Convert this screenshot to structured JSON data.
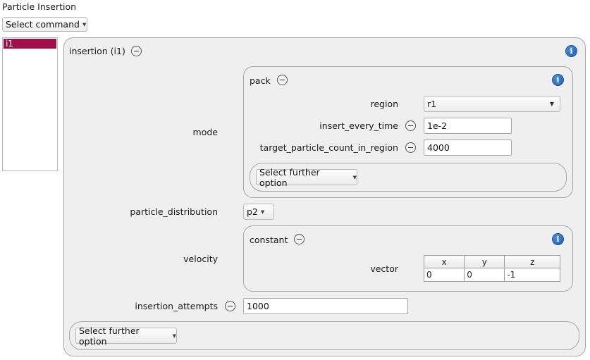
{
  "header": {
    "title": "Particle Insertion",
    "command_select": "Select command"
  },
  "list": {
    "items": [
      "i1"
    ]
  },
  "insertion": {
    "title": "insertion (i1)",
    "mode_label": "mode",
    "pack": {
      "title": "pack",
      "region_label": "region",
      "region_value": "r1",
      "insert_every_time_label": "insert_every_time",
      "insert_every_time_value": "1e-2",
      "target_count_label": "target_particle_count_in_region",
      "target_count_value": "4000",
      "further_option": "Select further option"
    },
    "particle_distribution_label": "particle_distribution",
    "particle_distribution_value": "p2",
    "velocity_label": "velocity",
    "constant": {
      "title": "constant",
      "vector_label": "vector",
      "columns": [
        "x",
        "y",
        "z"
      ],
      "values": [
        "0",
        "0",
        "-1"
      ]
    },
    "insertion_attempts_label": "insertion_attempts",
    "insertion_attempts_value": "1000",
    "further_option": "Select further option"
  },
  "icons": {
    "info_glyph": "i",
    "dropdown_glyph": "▼"
  },
  "colors": {
    "selection": "#a10e4b",
    "info_icon": "#1c5aa6",
    "panel_bg": "#efefef"
  }
}
